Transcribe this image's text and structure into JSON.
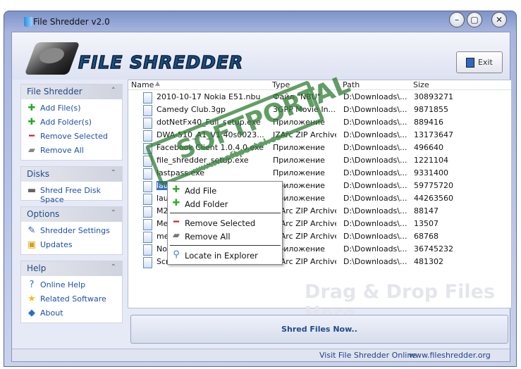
{
  "window": {
    "title": "File Shredder v2.0",
    "minimize": "–",
    "maximize": "▢",
    "close": "✕"
  },
  "header": {
    "logo_text": "FILE SHREDDER",
    "exit_label": "Exit"
  },
  "sidebar": [
    {
      "title": "File Shredder",
      "items": [
        {
          "label": "Add File(s)",
          "icon": "plus-icon"
        },
        {
          "label": "Add Folder(s)",
          "icon": "plus-icon"
        },
        {
          "label": "Remove Selected",
          "icon": "minus-icon"
        },
        {
          "label": "Remove All",
          "icon": "eraser-icon"
        }
      ]
    },
    {
      "title": "Disks",
      "items": [
        {
          "label": "Shred Free Disk Space",
          "icon": "disk-icon"
        }
      ]
    },
    {
      "title": "Options",
      "items": [
        {
          "label": "Shredder Settings",
          "icon": "settings-icon"
        },
        {
          "label": "Updates",
          "icon": "updates-icon"
        }
      ]
    },
    {
      "title": "Help",
      "items": [
        {
          "label": "Online Help",
          "icon": "help-icon"
        },
        {
          "label": "Related Software",
          "icon": "star-icon"
        },
        {
          "label": "About",
          "icon": "info-icon"
        }
      ]
    }
  ],
  "list": {
    "columns": [
      "Name",
      "Type",
      "Path",
      "Size"
    ],
    "rows": [
      {
        "name": "2010-10-17 Nokia E51.nbu",
        "type": "Файл \"NBU\"",
        "path": "D:\\Downloads\\...",
        "size": "30893271"
      },
      {
        "name": "Camedy Club.3gp",
        "type": "3GPP Movie In...",
        "path": "D:\\Downloads\\...",
        "size": "9871855"
      },
      {
        "name": "dotNetFx40_Full_setup.exe",
        "type": "Приложение",
        "path": "D:\\Downloads\\...",
        "size": "889416"
      },
      {
        "name": "DWA-510_A1_V1.40s0023...",
        "type": "IZArc ZIP Archive",
        "path": "D:\\Downloads\\...",
        "size": "13173647"
      },
      {
        "name": "Facebook Client 1.0.4.0.exe",
        "type": "Приложение",
        "path": "D:\\Downloads\\...",
        "size": "496640"
      },
      {
        "name": "file_shredder_setup.exe",
        "type": "Приложение",
        "path": "D:\\Downloads\\...",
        "size": "1221104"
      },
      {
        "name": "lastpass.exe",
        "type": "Приложение",
        "path": "D:\\Downloads\\...",
        "size": "9331400"
      },
      {
        "name": "lau",
        "type": "Приложение",
        "path": "D:\\Downloads\\...",
        "size": "59775720"
      },
      {
        "name": "lau",
        "type": "Приложение",
        "path": "D:\\Downloads\\...",
        "size": "44263560"
      },
      {
        "name": "M2",
        "type": "IZArc ZIP Archive",
        "path": "D:\\Downloads\\...",
        "size": "88147"
      },
      {
        "name": "Me",
        "type": "IZArc ZIP Archive",
        "path": "D:\\Downloads\\...",
        "size": "13507"
      },
      {
        "name": "me",
        "type": "IZArc ZIP Archive",
        "path": "D:\\Downloads\\...",
        "size": "68768"
      },
      {
        "name": "No",
        "type": "Приложение",
        "path": "D:\\Downloads\\...",
        "size": "36745232"
      },
      {
        "name": "Scr",
        "type": "IZArc ZIP Archive",
        "path": "D:\\Downloads\\...",
        "size": "481302"
      }
    ],
    "drag_hint": "Drag & Drop Files Here"
  },
  "context_menu": {
    "add_file": "Add File",
    "add_folder": "Add Folder",
    "remove_selected": "Remove Selected",
    "remove_all": "Remove All",
    "locate": "Locate in Explorer"
  },
  "shred_button": "Shred Files Now..",
  "status": {
    "visit": "Visit File Shredder Online",
    "url": "www.fileshredder.org"
  },
  "watermark": {
    "text": "SOFTPORTAL",
    "url": "www.softportal.com"
  }
}
